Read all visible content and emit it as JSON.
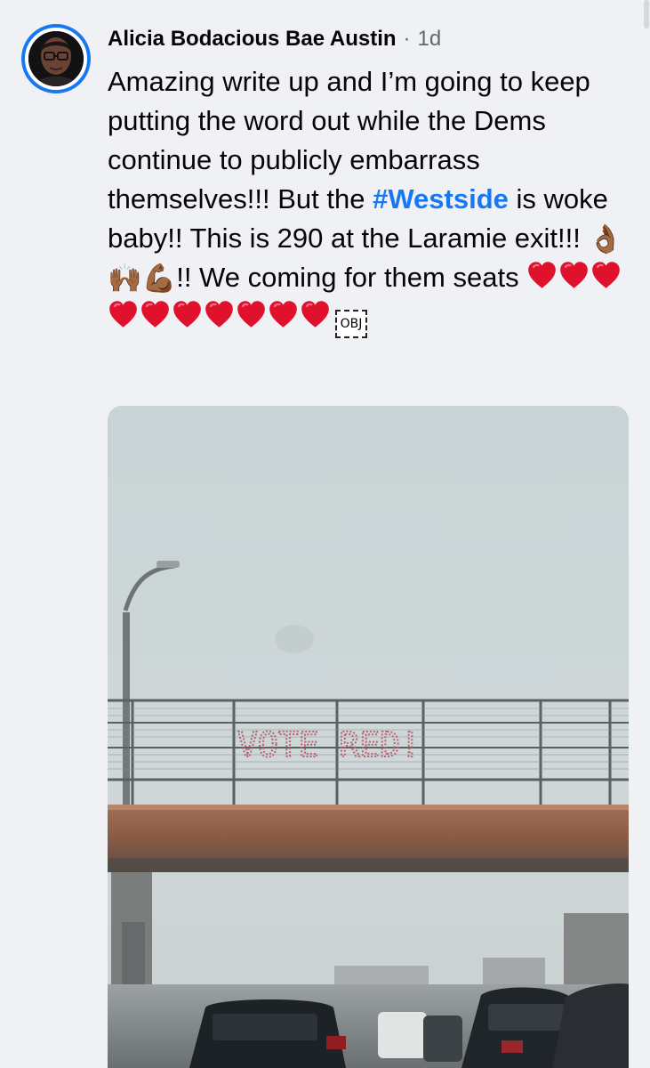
{
  "comment": {
    "author": "Alicia Bodacious Bae Austin",
    "separator": "·",
    "timestamp": "1d",
    "text_parts": {
      "part1": "Amazing write up and I’m going to keep putting the word out while the Dems continue to publicly embarrass themselves!!! But the ",
      "hashtag": "#Westside",
      "part2": " is woke baby!! This is 290 at the Laramie exit!!! ",
      "emoji_ok": "👌🏾",
      "emoji_raised": "🙌🏾",
      "emoji_muscle": "💪🏾",
      "part3": "!! We coming for them seats ",
      "obj_label": "OBJ"
    },
    "heart_count": 10
  },
  "photo": {
    "sign_text": "VOTE RED!",
    "colors": {
      "sky": "#cdd7d9",
      "bridge": "#8e5a45",
      "sign": "#b86370"
    }
  },
  "colors": {
    "accent": "#1877f2",
    "muted": "#65676b",
    "background": "#eff1f4"
  }
}
